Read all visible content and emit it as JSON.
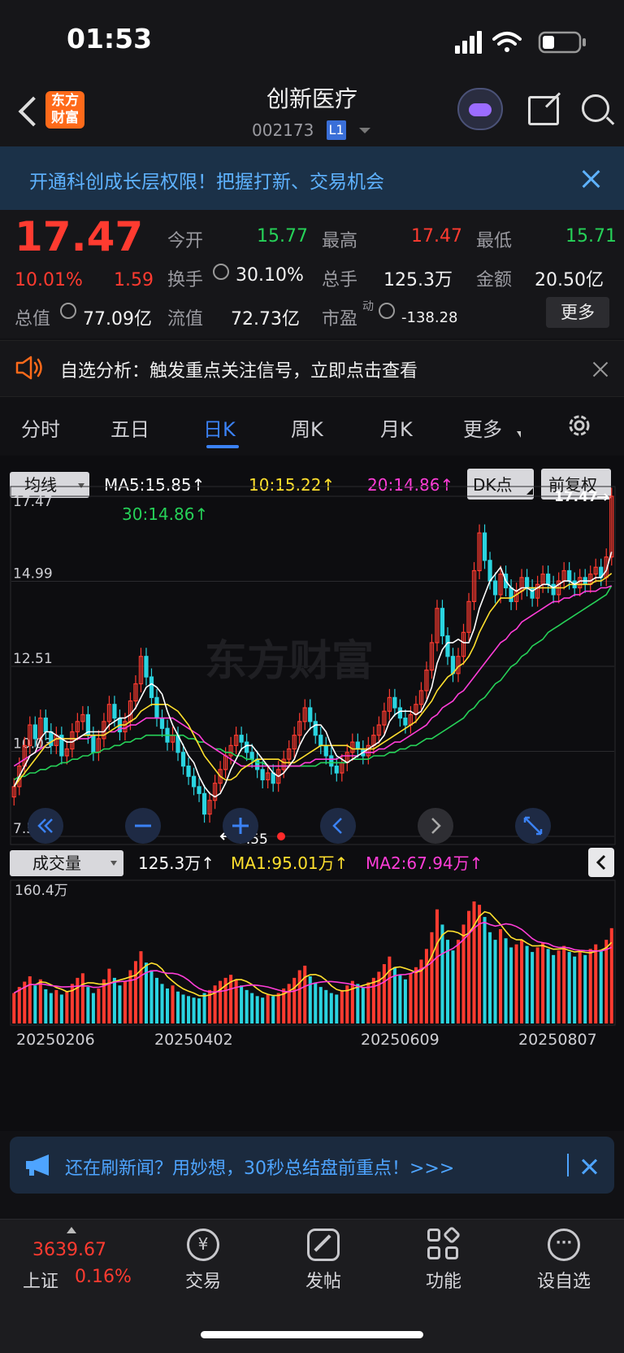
{
  "status": {
    "time": "01:53"
  },
  "nav": {
    "logo": "东方财富",
    "title": "创新医疗",
    "code": "002173",
    "level": "L1"
  },
  "banner": {
    "text": "开通科创成长层权限！把握打新、交易机会"
  },
  "quote": {
    "price": "17.47",
    "pct": "10.01%",
    "change": "1.59",
    "open_label": "今开",
    "open": "15.77",
    "high_label": "最高",
    "high": "17.47",
    "low_label": "最低",
    "low": "15.71",
    "turnover_label": "换手",
    "turnover": "30.10%",
    "vol_label": "总手",
    "vol": "125.3万",
    "amount_label": "金额",
    "amount": "20.50亿",
    "mcap_label": "总值",
    "mcap": "77.09亿",
    "float_label": "流值",
    "float": "72.73亿",
    "pe_label": "市盈",
    "pe_sup": "动",
    "pe": "-138.28",
    "more": "更多"
  },
  "notice": {
    "text": "自选分析：触发重点关注信号，立即点击查看"
  },
  "tabs": [
    "分时",
    "五日",
    "日K",
    "周K",
    "月K",
    "更多"
  ],
  "active_tab": "日K",
  "chart_controls": {
    "indicator": "均线",
    "ma5": "MA5:15.85↑",
    "ma10": "10:15.22↑",
    "ma20": "20:14.86↑",
    "ma30": "30:14.86↑",
    "dk": "DK点",
    "adjust": "前复权",
    "vol_indicator": "成交量",
    "vol_now": "125.3万↑",
    "vol_ma1": "MA1:95.01万↑",
    "vol_ma2": "MA2:67.94万↑",
    "vol_axis": "160.4万",
    "watermark": "东方财富"
  },
  "colors": {
    "up": "#ff3b30",
    "down": "#2ad4e0",
    "ma5": "#ffffff",
    "ma10": "#ffe02e",
    "ma20": "#ff3dd8",
    "ma30": "#26d158"
  },
  "chart_data": {
    "type": "candlestick",
    "y_ticks": [
      "17.47",
      "14.99",
      "12.51",
      "10.03",
      "7.55"
    ],
    "ylim": [
      7.55,
      17.47
    ],
    "last_label": "17.47",
    "min_label": "7.55",
    "x_ticks": [
      "20250206",
      "20250402",
      "20250609",
      "20250807"
    ],
    "close": [
      9.0,
      9.6,
      10.2,
      10.8,
      10.4,
      11.0,
      10.6,
      10.2,
      10.5,
      9.9,
      10.1,
      10.6,
      10.9,
      11.1,
      10.5,
      10.0,
      10.4,
      10.9,
      11.4,
      11.0,
      10.6,
      10.9,
      11.5,
      12.0,
      12.8,
      12.2,
      11.6,
      11.0,
      10.7,
      10.3,
      10.5,
      10.0,
      9.6,
      9.3,
      9.0,
      8.8,
      8.2,
      8.6,
      9.1,
      9.5,
      9.9,
      10.2,
      10.5,
      10.3,
      10.0,
      9.8,
      9.5,
      9.2,
      9.4,
      9.1,
      9.5,
      9.8,
      10.1,
      10.5,
      10.9,
      11.3,
      10.9,
      10.5,
      10.2,
      9.9,
      9.6,
      9.4,
      9.7,
      10.0,
      10.3,
      10.1,
      9.9,
      10.2,
      10.5,
      10.8,
      11.2,
      11.6,
      11.3,
      11.0,
      10.8,
      11.1,
      11.4,
      11.8,
      12.4,
      13.2,
      14.2,
      13.4,
      12.8,
      12.3,
      12.8,
      13.5,
      14.4,
      15.3,
      16.4,
      15.6,
      15.0,
      14.6,
      15.2,
      14.8,
      14.4,
      14.7,
      15.1,
      14.8,
      14.5,
      14.9,
      15.2,
      14.9,
      14.6,
      15.0,
      15.3,
      15.0,
      14.8,
      15.1,
      14.9,
      15.2,
      15.4,
      15.1,
      15.7,
      17.47
    ],
    "volume": [
      40,
      48,
      55,
      62,
      50,
      58,
      45,
      40,
      44,
      38,
      42,
      52,
      60,
      66,
      48,
      40,
      46,
      58,
      72,
      60,
      50,
      55,
      70,
      82,
      95,
      80,
      70,
      60,
      52,
      46,
      50,
      42,
      38,
      36,
      34,
      33,
      40,
      44,
      50,
      56,
      60,
      64,
      58,
      50,
      44,
      40,
      36,
      34,
      38,
      36,
      40,
      46,
      52,
      60,
      70,
      76,
      62,
      54,
      48,
      44,
      40,
      38,
      44,
      50,
      56,
      52,
      48,
      54,
      60,
      68,
      78,
      88,
      74,
      64,
      58,
      66,
      74,
      84,
      98,
      120,
      150,
      130,
      110,
      96,
      110,
      130,
      148,
      160.4,
      156,
      140,
      120,
      110,
      124,
      112,
      100,
      104,
      110,
      102,
      94,
      100,
      106,
      98,
      90,
      96,
      102,
      94,
      88,
      94,
      90,
      98,
      104,
      96,
      110,
      125.3
    ],
    "ma5": [
      9.0,
      9.3,
      9.6,
      9.9,
      10.0,
      10.4,
      10.6,
      10.6,
      10.5,
      10.4,
      10.3,
      10.3,
      10.4,
      10.5,
      10.6,
      10.6,
      10.6,
      10.6,
      10.8,
      10.9,
      11.0,
      11.0,
      11.1,
      11.3,
      11.6,
      11.9,
      12.0,
      11.9,
      11.7,
      11.2,
      10.8,
      10.5,
      10.2,
      9.9,
      9.7,
      9.3,
      9.0,
      8.8,
      8.7,
      8.8,
      9.1,
      9.5,
      9.8,
      10.1,
      10.2,
      10.2,
      10.0,
      9.8,
      9.6,
      9.4,
      9.3,
      9.4,
      9.6,
      9.8,
      10.2,
      10.5,
      10.7,
      10.8,
      10.8,
      10.6,
      10.2,
      9.9,
      9.8,
      9.7,
      9.8,
      9.9,
      10.0,
      10.1,
      10.2,
      10.3,
      10.5,
      10.9,
      11.1,
      11.2,
      11.2,
      11.2,
      11.1,
      11.2,
      11.5,
      11.9,
      12.6,
      13.0,
      13.2,
      13.2,
      13.3,
      13.2,
      13.2,
      13.6,
      14.2,
      14.6,
      15.0,
      15.2,
      15.4,
      15.0,
      14.8,
      14.7,
      14.8,
      14.8,
      14.7,
      14.8,
      14.9,
      14.9,
      14.8,
      14.9,
      15.0,
      15.0,
      14.9,
      15.0,
      15.0,
      15.0,
      15.1,
      15.1,
      15.3,
      15.85
    ],
    "ma10": [
      9.0,
      9.2,
      9.4,
      9.6,
      9.8,
      10.0,
      10.2,
      10.3,
      10.4,
      10.4,
      10.4,
      10.4,
      10.4,
      10.5,
      10.5,
      10.5,
      10.5,
      10.5,
      10.6,
      10.7,
      10.8,
      10.8,
      10.9,
      11.0,
      11.2,
      11.3,
      11.4,
      11.4,
      11.4,
      11.4,
      11.3,
      11.2,
      11.0,
      10.8,
      10.5,
      10.2,
      9.9,
      9.7,
      9.5,
      9.3,
      9.2,
      9.2,
      9.3,
      9.5,
      9.6,
      9.7,
      9.8,
      9.8,
      9.8,
      9.8,
      9.8,
      9.7,
      9.7,
      9.7,
      9.8,
      9.9,
      10.0,
      10.1,
      10.2,
      10.2,
      10.2,
      10.2,
      10.2,
      10.2,
      10.1,
      10.1,
      10.1,
      10.1,
      10.1,
      10.2,
      10.3,
      10.4,
      10.5,
      10.6,
      10.7,
      10.8,
      10.9,
      11.1,
      11.3,
      11.5,
      11.8,
      12.0,
      12.2,
      12.3,
      12.5,
      12.6,
      12.8,
      13.1,
      13.5,
      13.8,
      14.1,
      14.3,
      14.5,
      14.5,
      14.5,
      14.6,
      14.7,
      14.8,
      14.8,
      14.8,
      14.8,
      14.8,
      14.8,
      14.8,
      14.8,
      14.9,
      14.9,
      14.9,
      14.9,
      14.9,
      15.0,
      15.0,
      15.1,
      15.22
    ],
    "ma20": [
      9.6,
      9.7,
      9.8,
      9.9,
      10.0,
      10.1,
      10.2,
      10.3,
      10.4,
      10.4,
      10.4,
      10.4,
      10.4,
      10.4,
      10.4,
      10.5,
      10.5,
      10.5,
      10.6,
      10.6,
      10.7,
      10.7,
      10.8,
      10.8,
      10.9,
      11.0,
      11.0,
      11.0,
      11.0,
      11.0,
      11.0,
      10.9,
      10.8,
      10.7,
      10.6,
      10.5,
      10.3,
      10.2,
      10.1,
      10.0,
      9.9,
      9.8,
      9.7,
      9.6,
      9.6,
      9.6,
      9.6,
      9.6,
      9.6,
      9.6,
      9.6,
      9.6,
      9.6,
      9.6,
      9.6,
      9.7,
      9.7,
      9.8,
      9.8,
      9.8,
      9.8,
      9.8,
      9.9,
      9.9,
      9.9,
      9.9,
      10.0,
      10.0,
      10.0,
      10.1,
      10.1,
      10.2,
      10.3,
      10.3,
      10.4,
      10.5,
      10.6,
      10.7,
      10.8,
      11.0,
      11.1,
      11.3,
      11.4,
      11.5,
      11.7,
      11.8,
      12.0,
      12.2,
      12.4,
      12.6,
      12.8,
      13.0,
      13.2,
      13.3,
      13.5,
      13.6,
      13.8,
      13.9,
      14.0,
      14.1,
      14.2,
      14.3,
      14.4,
      14.4,
      14.5,
      14.5,
      14.6,
      14.6,
      14.7,
      14.7,
      14.7,
      14.8,
      14.8,
      14.86
    ],
    "ma30": [
      9.2,
      9.3,
      9.3,
      9.4,
      9.4,
      9.5,
      9.5,
      9.6,
      9.6,
      9.7,
      9.7,
      9.8,
      9.8,
      9.9,
      9.9,
      10.0,
      10.0,
      10.1,
      10.1,
      10.2,
      10.2,
      10.3,
      10.3,
      10.4,
      10.4,
      10.5,
      10.5,
      10.5,
      10.5,
      10.5,
      10.5,
      10.5,
      10.5,
      10.4,
      10.4,
      10.3,
      10.3,
      10.2,
      10.1,
      10.1,
      10.0,
      10.0,
      9.9,
      9.9,
      9.8,
      9.8,
      9.7,
      9.7,
      9.6,
      9.6,
      9.6,
      9.6,
      9.6,
      9.6,
      9.6,
      9.6,
      9.6,
      9.6,
      9.7,
      9.7,
      9.7,
      9.7,
      9.7,
      9.7,
      9.8,
      9.8,
      9.8,
      9.8,
      9.9,
      9.9,
      9.9,
      10.0,
      10.0,
      10.1,
      10.1,
      10.2,
      10.2,
      10.3,
      10.4,
      10.4,
      10.5,
      10.6,
      10.7,
      10.8,
      10.9,
      11.0,
      11.2,
      11.3,
      11.5,
      11.6,
      11.8,
      12.0,
      12.1,
      12.3,
      12.5,
      12.6,
      12.8,
      12.9,
      13.1,
      13.2,
      13.3,
      13.5,
      13.6,
      13.7,
      13.8,
      13.9,
      14.0,
      14.1,
      14.2,
      14.3,
      14.4,
      14.5,
      14.6,
      14.86
    ]
  },
  "footer": {
    "promo": "还在刷新闻？用妙想，30秒总结盘前重点！>>>",
    "index_value": "3639.67",
    "index_name": "上证",
    "index_pct": "0.16%",
    "tabs": [
      "交易",
      "发帖",
      "功能",
      "设自选"
    ]
  }
}
